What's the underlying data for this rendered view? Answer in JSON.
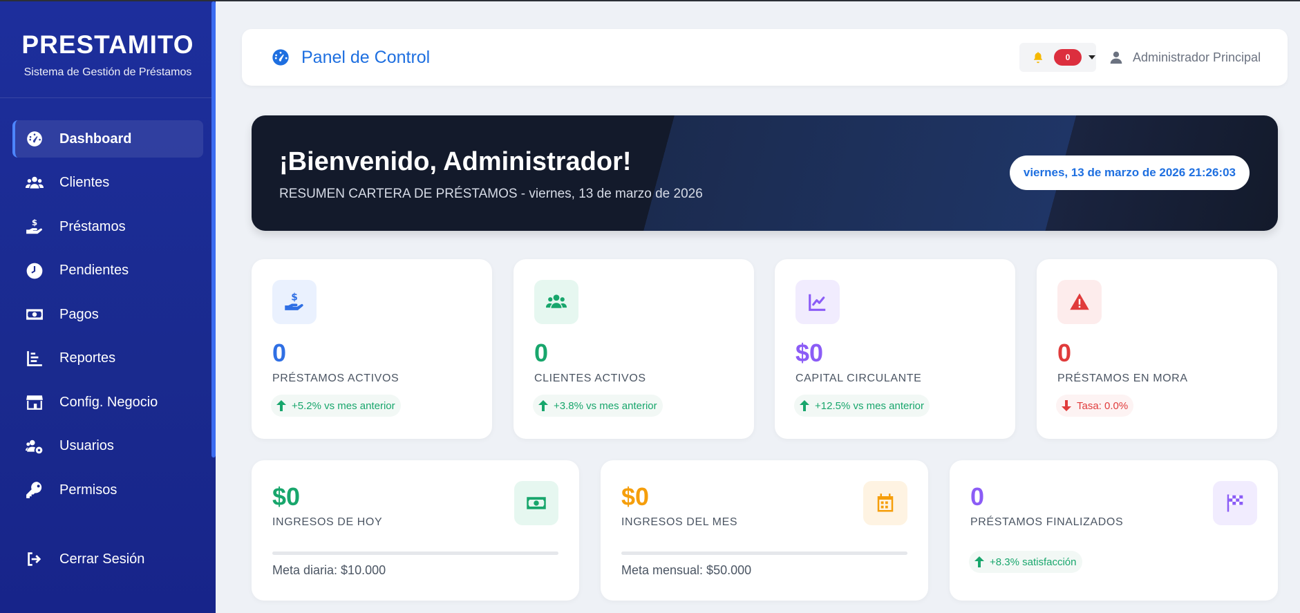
{
  "brand": {
    "title": "PRESTAMITO",
    "subtitle": "Sistema de Gestión de Préstamos"
  },
  "sidebar": {
    "items": [
      {
        "label": "Dashboard",
        "icon": "tachometer-icon",
        "active": true
      },
      {
        "label": "Clientes",
        "icon": "users-icon"
      },
      {
        "label": "Préstamos",
        "icon": "hand-holding-dollar-icon"
      },
      {
        "label": "Pendientes",
        "icon": "clock-icon"
      },
      {
        "label": "Pagos",
        "icon": "money-bill-icon"
      },
      {
        "label": "Reportes",
        "icon": "bar-chart-icon"
      },
      {
        "label": "Config. Negocio",
        "icon": "store-icon"
      },
      {
        "label": "Usuarios",
        "icon": "users-cog-icon"
      },
      {
        "label": "Permisos",
        "icon": "key-icon"
      }
    ],
    "logout": {
      "label": "Cerrar Sesión",
      "icon": "sign-out-icon"
    }
  },
  "header": {
    "title": "Panel de Control",
    "notifications_count": "0",
    "user": "Administrador Principal"
  },
  "banner": {
    "greeting": "¡Bienvenido, Administrador!",
    "subtitle": "RESUMEN CARTERA DE PRÉSTAMOS - viernes, 13 de marzo de 2026",
    "datetime": "viernes, 13 de marzo de 2026 21:26:03"
  },
  "stats": [
    {
      "value": "0",
      "label": "PRÉSTAMOS ACTIVOS",
      "trend": "+5.2% vs mes anterior",
      "direction": "up",
      "color": "#2f6fe4",
      "icon_bg": "#eaf1fe",
      "icon": "hand-holding-dollar-icon"
    },
    {
      "value": "0",
      "label": "CLIENTES ACTIVOS",
      "trend": "+3.8% vs mes anterior",
      "direction": "up",
      "color": "#18a66c",
      "icon_bg": "#e6f7f0",
      "icon": "users-icon"
    },
    {
      "value": "$0",
      "label": "CAPITAL CIRCULANTE",
      "trend": "+12.5% vs mes anterior",
      "direction": "up",
      "color": "#8b5cf6",
      "icon_bg": "#f1ecfe",
      "icon": "line-chart-icon"
    },
    {
      "value": "0",
      "label": "PRÉSTAMOS EN MORA",
      "trend": "Tasa: 0.0%",
      "direction": "down",
      "color": "#e03b3b",
      "icon_bg": "#fdecec",
      "icon": "warning-icon"
    }
  ],
  "summary": [
    {
      "value": "$0",
      "label": "INGRESOS DE HOY",
      "meta": "Meta diaria: $10.000",
      "progress": 0,
      "color": "#18a66c",
      "icon_bg": "#e6f7f0",
      "icon": "money-bill-icon"
    },
    {
      "value": "$0",
      "label": "INGRESOS DEL MES",
      "meta": "Meta mensual: $50.000",
      "progress": 0,
      "color": "#f59e0b",
      "icon_bg": "#fef3e2",
      "icon": "calendar-icon"
    },
    {
      "value": "0",
      "label": "PRÉSTAMOS FINALIZADOS",
      "trend": "+8.3% satisfacción",
      "color": "#8b5cf6",
      "icon_bg": "#f1ecfe",
      "icon": "flag-checkered-icon"
    }
  ]
}
